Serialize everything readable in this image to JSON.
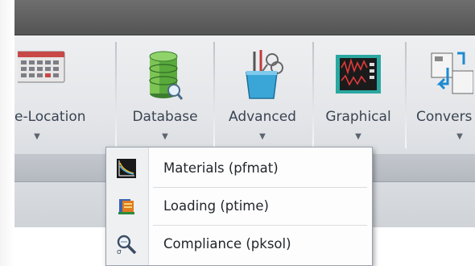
{
  "ribbon": {
    "buttons": [
      {
        "label": "e-Location",
        "icon": "calendar-grid-icon"
      },
      {
        "label": "Database",
        "icon": "database-icon"
      },
      {
        "label": "Advanced",
        "icon": "tools-beaker-icon"
      },
      {
        "label": "Graphical",
        "icon": "oscilloscope-icon"
      },
      {
        "label": "Convers",
        "icon": "convert-icon"
      }
    ]
  },
  "dropdown": {
    "items": [
      {
        "label": "Materials (pfmat)",
        "icon": "materials-chart-icon"
      },
      {
        "label": "Loading (ptime)",
        "icon": "loading-book-icon"
      },
      {
        "label": "Compliance (pksol)",
        "icon": "compliance-search-icon"
      }
    ]
  }
}
